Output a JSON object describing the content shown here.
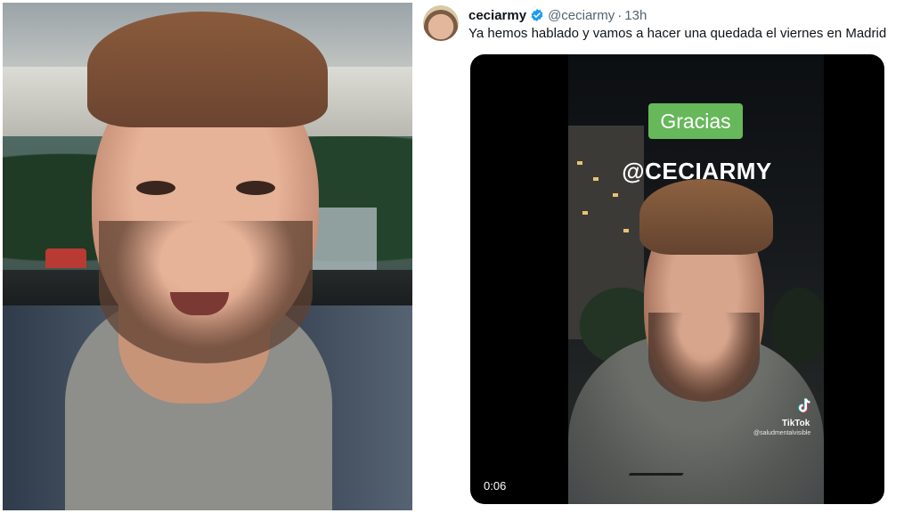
{
  "tweet": {
    "display_name": "ceciarmy",
    "handle": "@ceciarmy",
    "separator": "·",
    "time": "13h",
    "text": "Ya hemos hablado y vamos a hacer una quedada el viernes en Madrid",
    "verified_color": "#1d9bf0"
  },
  "video": {
    "caption_box": "Gracias",
    "caption_mention": "@CECIARMY",
    "watermark_label": "TikTok",
    "watermark_user": "@saludmentalvisible",
    "elapsed": "0:06",
    "caption_box_color": "#66b85a"
  },
  "icons": {
    "verified": "verified-badge-icon",
    "tiktok": "tiktok-logo-icon"
  }
}
